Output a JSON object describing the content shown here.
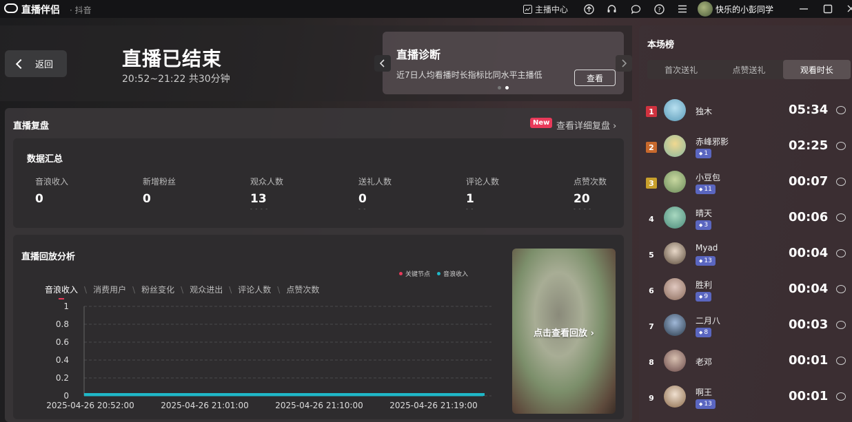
{
  "titlebar": {
    "app_name": "直播伴侣",
    "app_sub": "· 抖音",
    "host_center": "主播中心",
    "user_name": "快乐的小彭同学"
  },
  "header": {
    "back_label": "返回",
    "title": "直播已结束",
    "time_range": "20:52~21:22 共30分钟"
  },
  "diagnosis": {
    "title": "直播诊断",
    "text": "近7日人均看播时长指标比同水平主播低",
    "button": "查看"
  },
  "review": {
    "title": "直播复盘",
    "new_badge": "New",
    "detail_link": "查看详细复盘 ›"
  },
  "summary": {
    "title": "数据汇总",
    "metrics": [
      {
        "label": "音浪收入",
        "value": "0",
        "sub": ""
      },
      {
        "label": "新增粉丝",
        "value": "0",
        "sub": ""
      },
      {
        "label": "观众人数",
        "value": "13",
        "sub": "- - - -"
      },
      {
        "label": "送礼人数",
        "value": "0",
        "sub": "- -"
      },
      {
        "label": "评论人数",
        "value": "1",
        "sub": "- -"
      },
      {
        "label": "点赞次数",
        "value": "20",
        "sub": "- - - -"
      }
    ]
  },
  "analysis": {
    "title": "直播回放分析",
    "legend": [
      {
        "label": "关键节点",
        "color": "#e83a5a"
      },
      {
        "label": "音浪收入",
        "color": "#1fb8c8"
      }
    ],
    "tabs": [
      "音浪收入",
      "消费用户",
      "粉丝变化",
      "观众进出",
      "评论人数",
      "点赞次数"
    ],
    "replay_label": "点击查看回放 ›"
  },
  "chart_data": {
    "type": "area",
    "series": [
      {
        "name": "音浪收入",
        "values": [
          0,
          0,
          0,
          0,
          0
        ]
      }
    ],
    "x": [
      "2025-04-26 20:52:00",
      "2025-04-26 21:01:00",
      "2025-04-26 21:10:00",
      "2025-04-26 21:19:00",
      "2025-04-26 21:22:00"
    ],
    "x_ticks": [
      "2025-04-26 20:52:00",
      "2025-04-26 21:01:00",
      "2025-04-26 21:10:00",
      "2025-04-26 21:19:00"
    ],
    "y_ticks": [
      "0",
      "0.2",
      "0.4",
      "0.6",
      "0.8",
      "1"
    ],
    "ylim": [
      0,
      1
    ],
    "grid": true
  },
  "ranking": {
    "title": "本场榜",
    "tabs": [
      "首次送礼",
      "点赞送礼",
      "观看时长"
    ],
    "active_tab": 2,
    "rows": [
      {
        "rank": "1",
        "name": "独木",
        "level": "",
        "time": "05:34"
      },
      {
        "rank": "2",
        "name": "赤峰邪影",
        "level": "1",
        "time": "02:25"
      },
      {
        "rank": "3",
        "name": "小豆包",
        "level": "11",
        "time": "00:07"
      },
      {
        "rank": "4",
        "name": "晴天",
        "level": "3",
        "time": "00:06"
      },
      {
        "rank": "5",
        "name": "Myad",
        "level": "13",
        "time": "00:04"
      },
      {
        "rank": "6",
        "name": "胜利",
        "level": "9",
        "time": "00:04"
      },
      {
        "rank": "7",
        "name": "二月八",
        "level": "8",
        "time": "00:03"
      },
      {
        "rank": "8",
        "name": "老邓",
        "level": "",
        "time": "00:01"
      },
      {
        "rank": "9",
        "name": "啊王",
        "level": "13",
        "time": "00:01"
      }
    ]
  },
  "colors": {
    "rank1": "#d0323f",
    "rank2": "#c8692c",
    "rank3": "#c8a02c",
    "accent_teal": "#1fb8c8",
    "accent_red": "#e83a5a"
  }
}
